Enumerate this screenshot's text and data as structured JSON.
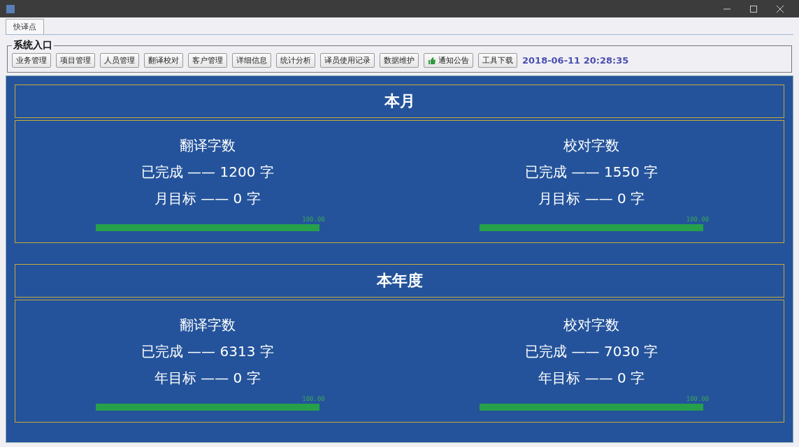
{
  "tabs": [
    {
      "label": "快译点",
      "selected": true
    }
  ],
  "group": {
    "title": "系统入口",
    "buttons": [
      {
        "label": "业务管理",
        "kind": "plain"
      },
      {
        "label": "项目管理",
        "kind": "plain"
      },
      {
        "label": "人员管理",
        "kind": "plain"
      },
      {
        "label": "翻译校对",
        "kind": "plain"
      },
      {
        "label": "客户管理",
        "kind": "plain"
      },
      {
        "label": "详细信息",
        "kind": "plain"
      },
      {
        "label": "统计分析",
        "kind": "plain"
      },
      {
        "label": "译员使用记录",
        "kind": "plain"
      },
      {
        "label": "数据维护",
        "kind": "plain"
      },
      {
        "label": "通知公告",
        "kind": "thumb"
      },
      {
        "label": "工具下载",
        "kind": "plain"
      }
    ],
    "datetime": "2018-06-11 20:28:35"
  },
  "sections": [
    {
      "title": "本月",
      "stats": [
        {
          "heading": "翻译字数",
          "done": "已完成 —— 1200 字",
          "target": "月目标 —— 0 字",
          "percent": "100.00",
          "level": 1
        },
        {
          "heading": "校对字数",
          "done": "已完成 —— 1550 字",
          "target": "月目标 —— 0 字",
          "percent": "100.00",
          "level": 1
        }
      ]
    },
    {
      "title": "本年度",
      "stats": [
        {
          "heading": "翻译字数",
          "done": "已完成 —— 6313 字",
          "target": "年目标 —— 0 字",
          "percent": "100.00",
          "level": 1
        },
        {
          "heading": "校对字数",
          "done": "已完成 —— 7030 字",
          "target": "年目标 —— 0 字",
          "percent": "100.00",
          "level": 1
        }
      ]
    }
  ]
}
